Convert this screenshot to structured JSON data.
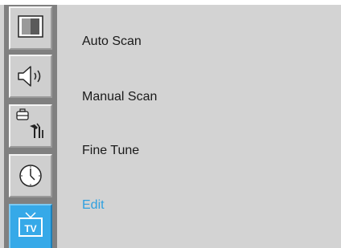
{
  "sidebar": {
    "tabs": [
      {
        "name": "picture",
        "icon": "picture-icon",
        "active": false
      },
      {
        "name": "sound",
        "icon": "speaker-icon",
        "active": false
      },
      {
        "name": "setup",
        "icon": "tools-icon",
        "active": false
      },
      {
        "name": "time",
        "icon": "clock-icon",
        "active": false
      },
      {
        "name": "tv",
        "icon": "tv-icon",
        "label": "TV",
        "active": true
      }
    ]
  },
  "menu": {
    "items": [
      {
        "label": "Auto Scan",
        "selected": false
      },
      {
        "label": "Manual Scan",
        "selected": false
      },
      {
        "label": "Fine Tune",
        "selected": false
      },
      {
        "label": "Edit",
        "selected": true
      }
    ]
  },
  "colors": {
    "background": "#d3d3d3",
    "sidebar": "#808080",
    "accent": "#2ea0e0",
    "text": "#1a1a1a"
  }
}
